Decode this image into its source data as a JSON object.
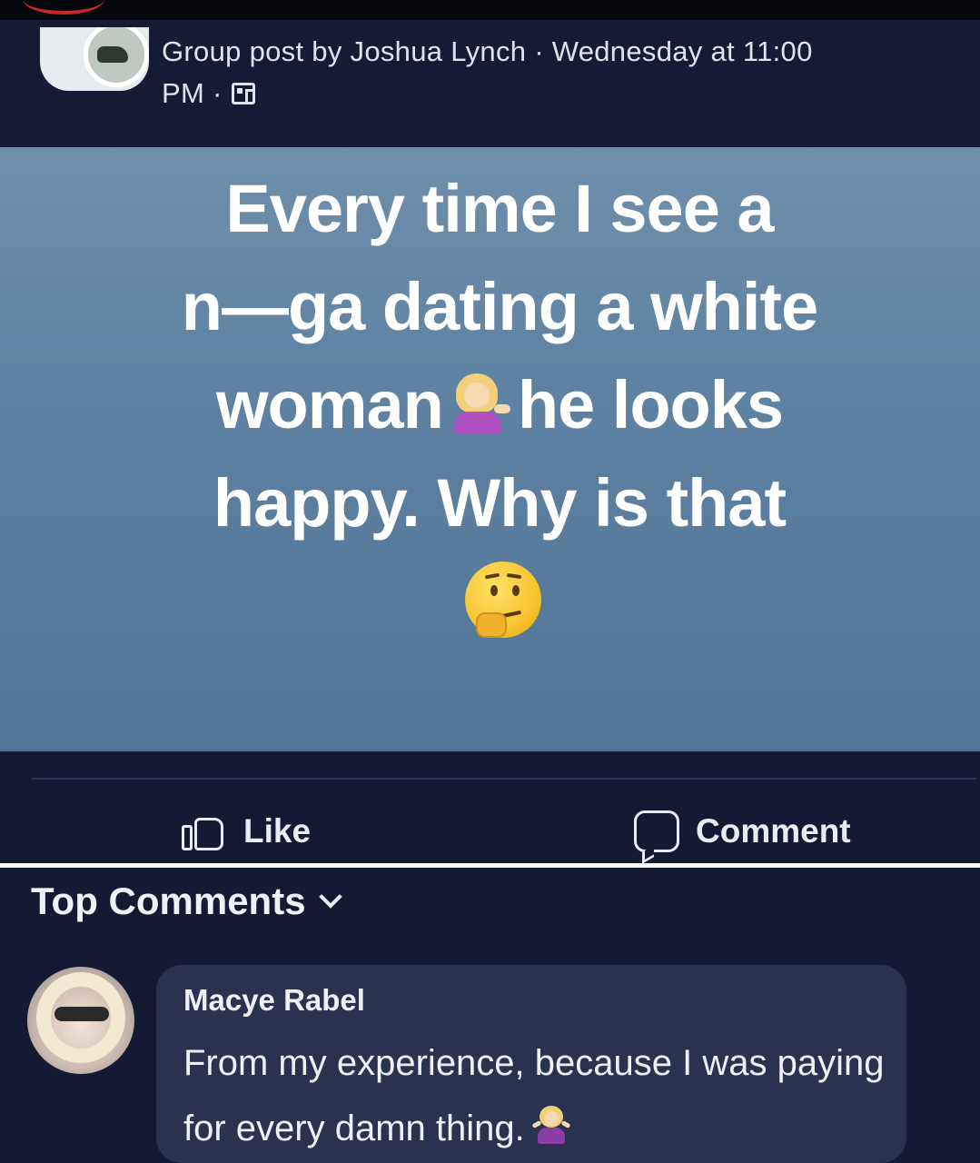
{
  "header": {
    "meta_line1": "Group post by Joshua Lynch · Wednesday at 11:00",
    "meta_line2": "PM ·",
    "audience_icon": "group-audience-icon"
  },
  "post": {
    "lines": [
      "Every time I see a",
      "n—ga dating a white",
      "woman",
      "he looks",
      "happy. Why is that"
    ],
    "emojis": [
      "woman-tipping-hand-emoji",
      "thinking-face-emoji"
    ],
    "background_color": "#6184a3"
  },
  "actions": {
    "like_label": "Like",
    "comment_label": "Comment"
  },
  "comments": {
    "sort_label": "Top Comments",
    "items": [
      {
        "author": "Macye Rabel",
        "text": "From my experience, because I was paying for every damn thing.",
        "emoji": "woman-shrugging-emoji"
      }
    ]
  }
}
